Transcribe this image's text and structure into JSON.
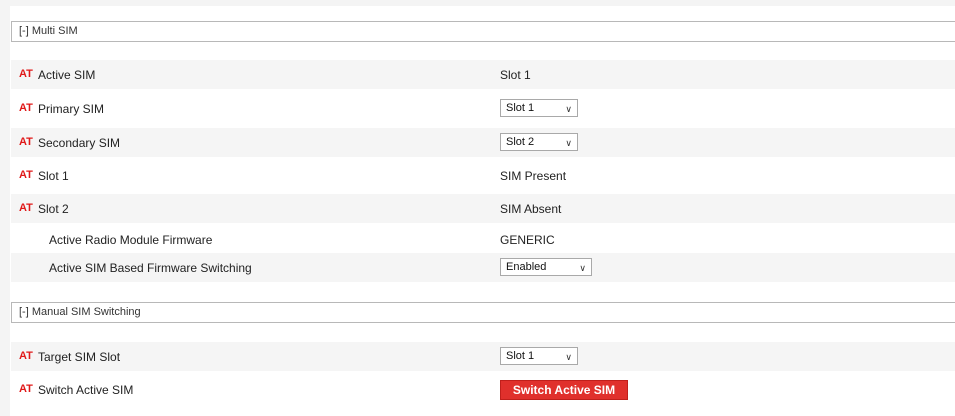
{
  "sections": {
    "multi_sim": {
      "title": "[-] Multi SIM"
    },
    "manual_switching": {
      "title": "[-] Manual SIM Switching"
    }
  },
  "badge": "AT",
  "rows": {
    "active_sim": {
      "label": "Active SIM",
      "value": "Slot 1"
    },
    "primary_sim": {
      "label": "Primary SIM",
      "selected": "Slot 1"
    },
    "secondary_sim": {
      "label": "Secondary SIM",
      "selected": "Slot 2"
    },
    "slot1": {
      "label": "Slot 1",
      "value": "SIM Present"
    },
    "slot2": {
      "label": "Slot 2",
      "value": "SIM Absent"
    },
    "radio_firmware": {
      "label": "Active Radio Module Firmware",
      "value": "GENERIC"
    },
    "fw_switching": {
      "label": "Active SIM Based Firmware Switching",
      "selected": "Enabled"
    },
    "target_slot": {
      "label": "Target SIM Slot",
      "selected": "Slot 1"
    },
    "switch_active": {
      "label": "Switch Active SIM",
      "button": "Switch Active SIM"
    }
  },
  "colors": {
    "at_badge": "#e01818",
    "button": "#e0302c",
    "alt_row": "#f5f5f5"
  },
  "icons": {
    "dropdown": "chevron-down-icon"
  }
}
